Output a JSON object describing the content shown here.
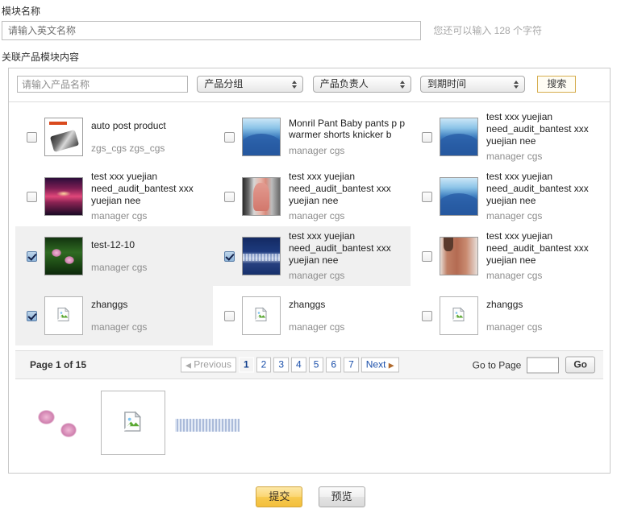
{
  "form": {
    "module_name_label": "模块名称",
    "module_name_placeholder": "请输入英文名称",
    "module_name_value": "",
    "module_name_hint": "您还可以输入 128 个字符",
    "related_label": "关联产品模块内容"
  },
  "filters": {
    "product_name_placeholder": "请输入产品名称",
    "product_name_value": "",
    "group_select": "产品分组",
    "owner_select": "产品负责人",
    "expiry_select": "到期时间",
    "search_button": "搜索"
  },
  "products": [
    {
      "title": "auto post product",
      "owner": "zgs_cgs zgs_cgs",
      "checked": false,
      "thumb": "phone-thumbnail",
      "short_title": true
    },
    {
      "title": "Monril Pant Baby pants p p warmer shorts knicker b",
      "owner": "manager cgs",
      "checked": false,
      "thumb": "blue-mountain-thumbnail",
      "short_title": false
    },
    {
      "title": "test xxx yuejian need_audit_bantest xxx yuejian nee",
      "owner": "manager cgs",
      "checked": false,
      "thumb": "blue-mountain-thumbnail",
      "short_title": false
    },
    {
      "title": "test xxx yuejian need_audit_bantest xxx yuejian nee",
      "owner": "manager cgs",
      "checked": false,
      "thumb": "sunset-thumbnail",
      "short_title": false
    },
    {
      "title": "test xxx yuejian need_audit_bantest xxx yuejian nee",
      "owner": "manager cgs",
      "checked": false,
      "thumb": "dress-thumbnail",
      "short_title": false
    },
    {
      "title": "test xxx yuejian need_audit_bantest xxx yuejian nee",
      "owner": "manager cgs",
      "checked": false,
      "thumb": "blue-mountain-thumbnail",
      "short_title": false
    },
    {
      "title": "test-12-10",
      "owner": "manager cgs",
      "checked": true,
      "thumb": "lotus-thumbnail",
      "short_title": true
    },
    {
      "title": "test xxx yuejian need_audit_bantest xxx yuejian nee",
      "owner": "manager cgs",
      "checked": true,
      "thumb": "waves-thumbnail",
      "short_title": false
    },
    {
      "title": "test xxx yuejian need_audit_bantest xxx yuejian nee",
      "owner": "manager cgs",
      "checked": false,
      "thumb": "coat-thumbnail",
      "short_title": false
    },
    {
      "title": "zhanggs",
      "owner": "manager cgs",
      "checked": true,
      "thumb": "broken-image-thumbnail",
      "short_title": true
    },
    {
      "title": "zhanggs",
      "owner": "manager cgs",
      "checked": false,
      "thumb": "broken-image-thumbnail",
      "short_title": true
    },
    {
      "title": "zhanggs",
      "owner": "manager cgs",
      "checked": false,
      "thumb": "broken-image-thumbnail",
      "short_title": true
    }
  ],
  "pagination": {
    "info": "Page 1 of 15",
    "current_page": 1,
    "total_pages": 15,
    "previous_label": "Previous",
    "next_label": "Next",
    "pages": [
      "1",
      "2",
      "3",
      "4",
      "5",
      "6",
      "7"
    ],
    "goto_label": "Go to Page",
    "goto_value": "",
    "goto_button": "Go"
  },
  "selected_tray": [
    {
      "thumb": "lotus-thumbnail",
      "bordered": false
    },
    {
      "thumb": "broken-image-thumbnail",
      "bordered": true
    },
    {
      "thumb": "waves-thumbnail",
      "bordered": false
    }
  ],
  "footer": {
    "submit_label": "提交",
    "preview_label": "预览"
  },
  "colors": {
    "accent_gold": "#f3bf3c",
    "link_blue": "#1a4faa",
    "selected_row_bg": "#f0f0f0",
    "search_border": "#d6ad4e"
  }
}
